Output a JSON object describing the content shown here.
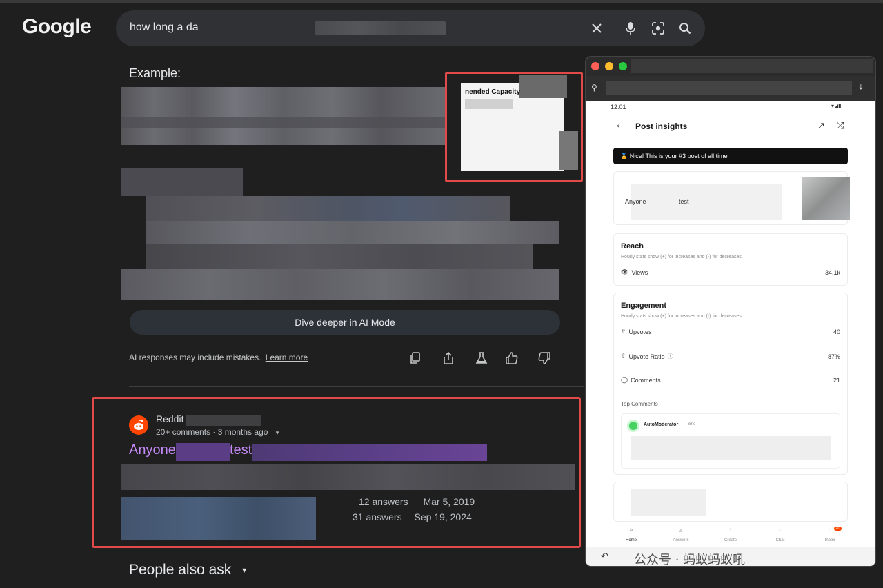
{
  "browser": {
    "logo": "Google",
    "search": {
      "query": "how long a da"
    }
  },
  "ai_overview": {
    "example_label": "Example:",
    "thumbnail_title": "nended Capacity",
    "ai_mode_button": "Dive deeper in AI Mode",
    "disclaimer": "AI responses may include mistakes.",
    "learn_more": "Learn more"
  },
  "result": {
    "site": "Reddit",
    "meta": "20+ comments · 3 months ago",
    "title_part1": "Anyone",
    "title_part2": "test",
    "answers": [
      {
        "count": "12 answers",
        "date": "Mar 5, 2019"
      },
      {
        "count": "31 answers",
        "date": "Sep 19, 2024"
      }
    ]
  },
  "people_also_ask": "People also ask",
  "phone": {
    "time": "12:01",
    "header": "Post insights",
    "banner": "🏅 Nice! This is your #3 post of all time",
    "post_title_a": "Anyone",
    "post_title_b": "test",
    "reach": {
      "title": "Reach",
      "sub": "Hourly stats show (+) for increases and (-) for decreases.",
      "views_label": "Views",
      "views_value": "34.1k"
    },
    "engagement": {
      "title": "Engagement",
      "sub": "Hourly stats show (+) for increases and (-) for decreases.",
      "upvotes_label": "Upvotes",
      "upvotes_value": "40",
      "ratio_label": "Upvote Ratio",
      "ratio_value": "87%",
      "comments_label": "Comments",
      "comments_value": "21",
      "top_comments": "Top Comments",
      "comment_author": "AutoModerator",
      "comment_time": "· 3mo"
    },
    "nav": [
      "Home",
      "Answers",
      "Create",
      "Chat",
      "Inbox"
    ],
    "inbox_badge": "20",
    "watermark": "公众号 · 蚂蚁蚂蚁吼"
  }
}
